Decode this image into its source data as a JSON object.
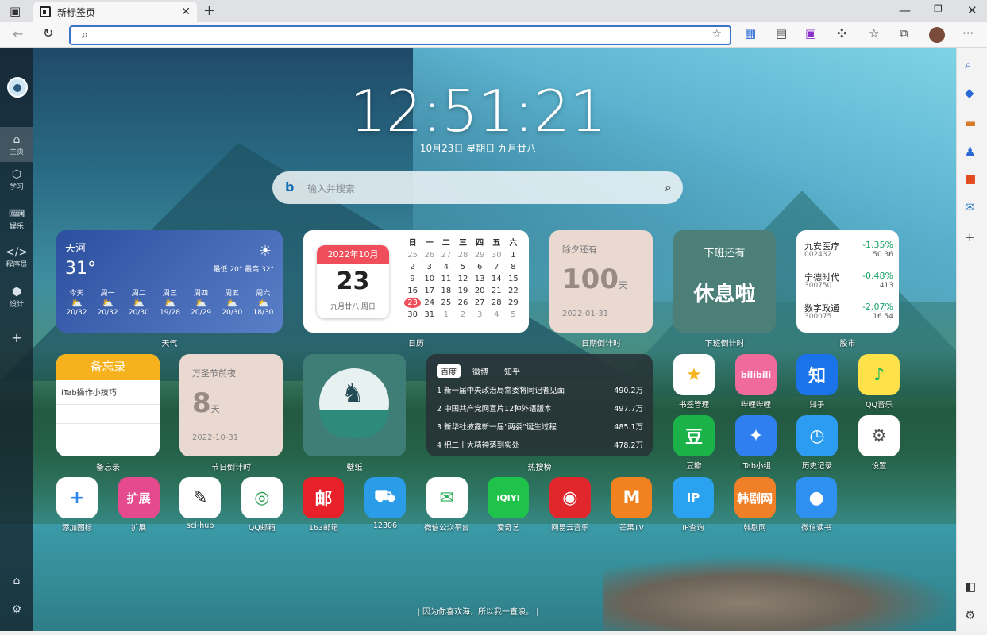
{
  "browser": {
    "tab_title": "新标签页",
    "address": ""
  },
  "sidebar": {
    "items": [
      {
        "label": "主页",
        "icon": "home-icon"
      },
      {
        "label": "学习",
        "icon": "cube-icon"
      },
      {
        "label": "娱乐",
        "icon": "gamepad-icon"
      },
      {
        "label": "程序员",
        "icon": "code-icon"
      },
      {
        "label": "设计",
        "icon": "box-icon"
      }
    ]
  },
  "clock": {
    "time": "12:51:21",
    "date": "10月23日  星期日  九月廿八"
  },
  "search": {
    "placeholder": "输入并搜索"
  },
  "weather": {
    "city": "天河",
    "temp": "31°",
    "range": "最低 20° 最高 32°",
    "label": "天气",
    "days": [
      {
        "name": "今天",
        "t": "20/32"
      },
      {
        "name": "周一",
        "t": "20/32"
      },
      {
        "name": "周二",
        "t": "20/30"
      },
      {
        "name": "周三",
        "t": "19/28"
      },
      {
        "name": "周四",
        "t": "20/29"
      },
      {
        "name": "周五",
        "t": "20/30"
      },
      {
        "name": "周六",
        "t": "18/30"
      }
    ]
  },
  "calendar": {
    "ym": "2022年10月",
    "day": "23",
    "lunar": "九月廿八 周日",
    "label": "日历",
    "head": [
      "日",
      "一",
      "二",
      "三",
      "四",
      "五",
      "六"
    ],
    "rows": [
      [
        "25",
        "26",
        "27",
        "28",
        "29",
        "30",
        "1"
      ],
      [
        "2",
        "3",
        "4",
        "5",
        "6",
        "7",
        "8"
      ],
      [
        "9",
        "10",
        "11",
        "12",
        "13",
        "14",
        "15"
      ],
      [
        "16",
        "17",
        "18",
        "19",
        "20",
        "21",
        "22"
      ],
      [
        "23",
        "24",
        "25",
        "26",
        "27",
        "28",
        "29"
      ],
      [
        "30",
        "31",
        "1",
        "2",
        "3",
        "4",
        "5"
      ]
    ]
  },
  "countdown1": {
    "title": "除夕还有",
    "days": "100",
    "unit": "天",
    "date": "2022-01-31",
    "label": "日期倒计时"
  },
  "offwork": {
    "title": "下班还有",
    "msg": "休息啦",
    "label": "下班倒计时"
  },
  "stocks": {
    "label": "股市",
    "items": [
      {
        "name": "九安医疗",
        "code": "002432",
        "pct": "-1.35%",
        "price": "50.36"
      },
      {
        "name": "宁德时代",
        "code": "300750",
        "pct": "-0.48%",
        "price": "413"
      },
      {
        "name": "数字政通",
        "code": "300075",
        "pct": "-2.07%",
        "price": "16.54"
      }
    ]
  },
  "memo": {
    "title": "备忘录",
    "text": "iTab操作小技巧",
    "label": "备忘录"
  },
  "countdown2": {
    "title": "万圣节前夜",
    "days": "8",
    "unit": "天",
    "date": "2022-10-31",
    "label": "节日倒计时"
  },
  "wallpaper": {
    "label": "壁纸"
  },
  "hot": {
    "label": "热搜榜",
    "tabs": [
      "百度",
      "微博",
      "知乎"
    ],
    "items": [
      {
        "n": "1",
        "t": "新一届中央政治局常委将同记者见面",
        "v": "490.2万"
      },
      {
        "n": "2",
        "t": "中国共产党网宣片12种外语版本",
        "v": "497.7万"
      },
      {
        "n": "3",
        "t": "新华社披露新一届\"两委\"诞生过程",
        "v": "485.1万"
      },
      {
        "n": "4",
        "t": "把二丨大精神落到实处",
        "v": "478.2万"
      }
    ]
  },
  "apps_right": [
    {
      "label": "书签管理",
      "glyph": "★",
      "bg": "#ffffff",
      "fg": "#f5b21c"
    },
    {
      "label": "哔哩哔哩",
      "glyph": "bilibili",
      "bg": "#f06a9b",
      "fg": "#ffffff"
    },
    {
      "label": "知乎",
      "glyph": "知",
      "bg": "#1a73e8",
      "fg": "#ffffff"
    },
    {
      "label": "QQ音乐",
      "glyph": "♪",
      "bg": "#ffe14a",
      "fg": "#1fb35a"
    },
    {
      "label": "豆瓣",
      "glyph": "豆",
      "bg": "#1bb349",
      "fg": "#ffffff"
    },
    {
      "label": "iTab小组",
      "glyph": "✦",
      "bg": "#2f7ff0",
      "fg": "#ffffff"
    },
    {
      "label": "历史记录",
      "glyph": "◷",
      "bg": "#2c9cf0",
      "fg": "#ffffff"
    },
    {
      "label": "设置",
      "glyph": "⚙",
      "bg": "#ffffff",
      "fg": "#555555"
    }
  ],
  "apps_bottom": [
    {
      "label": "添加图标",
      "glyph": "+",
      "bg": "#ffffff",
      "fg": "#2a86f0"
    },
    {
      "label": "扩展",
      "glyph": "扩展",
      "bg": "#e54a8e",
      "fg": "#ffffff"
    },
    {
      "label": "sci-hub",
      "glyph": "✎",
      "bg": "#ffffff",
      "fg": "#222222"
    },
    {
      "label": "QQ邮箱",
      "glyph": "◎",
      "bg": "#ffffff",
      "fg": "#2a9c4e"
    },
    {
      "label": "163邮箱",
      "glyph": "邮",
      "bg": "#e8202a",
      "fg": "#ffffff"
    },
    {
      "label": "12306",
      "glyph": "⛟",
      "bg": "#2a9ce8",
      "fg": "#ffffff"
    },
    {
      "label": "微信公众平台",
      "glyph": "✉",
      "bg": "#ffffff",
      "fg": "#2aae5a"
    },
    {
      "label": "爱奇艺",
      "glyph": "iQIYI",
      "bg": "#1fc24a",
      "fg": "#ffffff"
    },
    {
      "label": "网易云音乐",
      "glyph": "◉",
      "bg": "#e2272c",
      "fg": "#ffffff"
    },
    {
      "label": "芒果TV",
      "glyph": "M",
      "bg": "#f2821f",
      "fg": "#ffffff"
    },
    {
      "label": "IP查询",
      "glyph": "IP",
      "bg": "#2aa2f0",
      "fg": "#ffffff"
    },
    {
      "label": "韩剧网",
      "glyph": "韩剧网",
      "bg": "#f08028",
      "fg": "#ffffff"
    },
    {
      "label": "微信读书",
      "glyph": "●",
      "bg": "#2e90f0",
      "fg": "#ffffff"
    }
  ],
  "quote": "| 因为你喜欢海，所以我一直浪。 |"
}
